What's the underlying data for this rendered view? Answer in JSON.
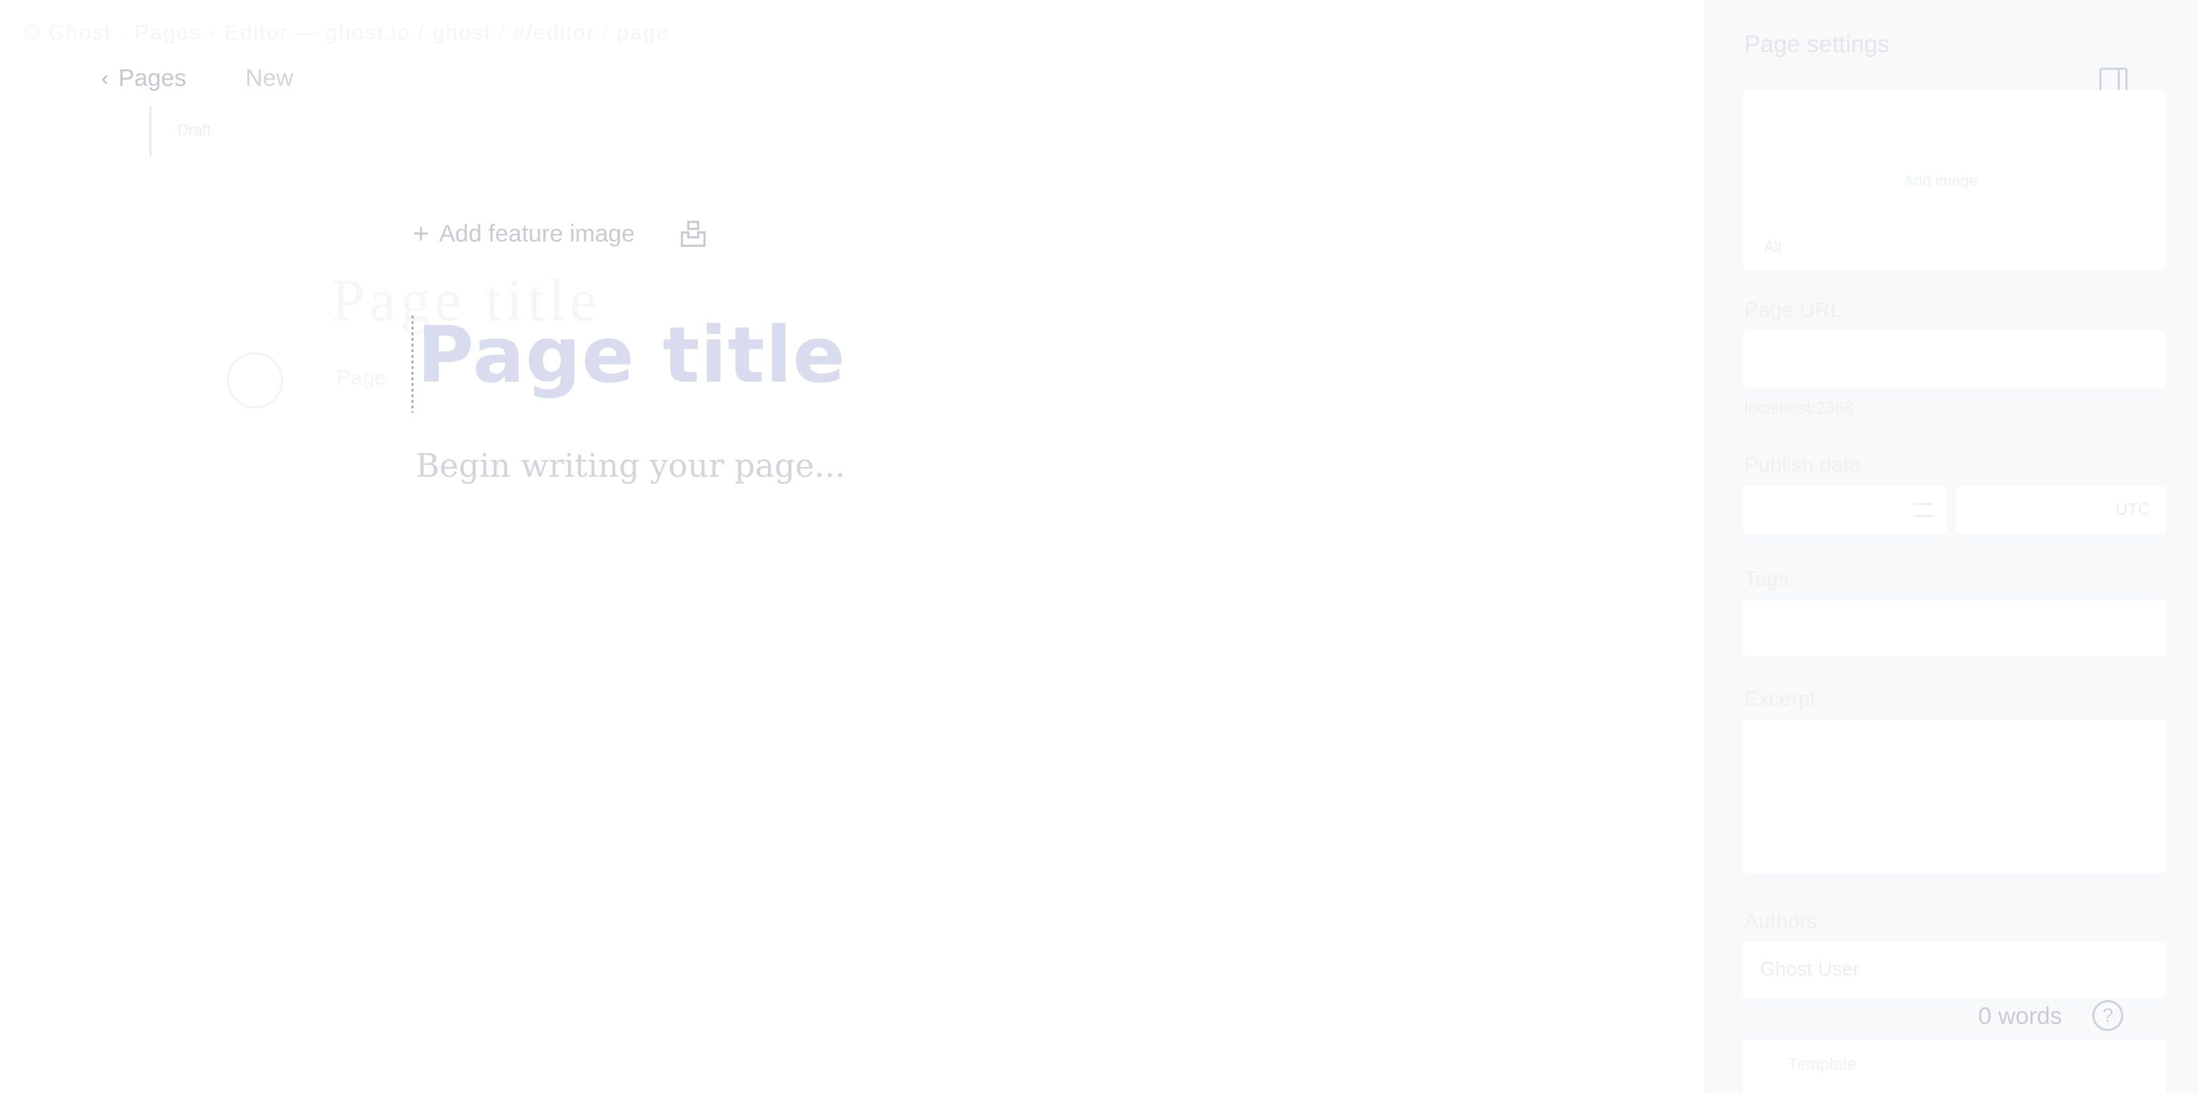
{
  "editor": {
    "ghost_url": "© Ghost · Pages · Editor — ghost.io / ghost / #/editor / page",
    "breadcrumb": {
      "parent_label": "Pages",
      "status_label": "New"
    },
    "faint_status": "Draft",
    "add_feature_image_label": "Add feature image",
    "ghost_title": "Page title",
    "ghost_small": "Page",
    "title_placeholder": "Page title",
    "body_placeholder": "Begin writing your page..."
  },
  "settings_panel": {
    "title": "Page settings",
    "image_box_hint": "Add image",
    "image_box_corner": "Alt",
    "fields": {
      "page_url_label": "Page URL",
      "page_url_hint": "localhost:2368",
      "publish_date_label": "Publish date",
      "time_zone": "UTC",
      "tags_label": "Tags",
      "excerpt_label": "Excerpt",
      "authors_label": "Authors",
      "authors_value": "Ghost User",
      "template_value": "Template"
    },
    "word_count": "0 words",
    "help_icon": "?"
  },
  "icons": {
    "back": "chevron-left-icon",
    "add": "plus-icon",
    "unsplash": "unsplash-icon",
    "panel_toggle": "sidebar-toggle-icon",
    "calendar": "calendar-icon",
    "help": "question-circle-icon"
  }
}
